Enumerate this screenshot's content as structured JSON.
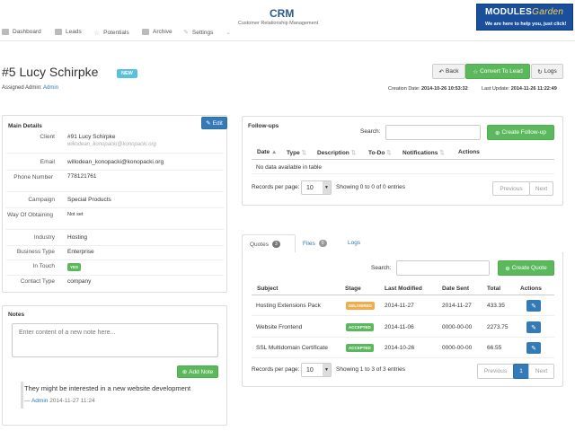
{
  "header": {
    "title": "CRM",
    "subtitle": "Customer Relationship Management",
    "nav": [
      {
        "label": "Dashboard",
        "icon": "chart-icon"
      },
      {
        "label": "Leads",
        "icon": "tag-icon"
      },
      {
        "label": "Potentials",
        "icon": "star-icon"
      },
      {
        "label": "Archive",
        "icon": "archive-icon"
      },
      {
        "label": "Settings",
        "icon": "wrench-icon"
      }
    ],
    "logo_line1a": "M",
    "logo_line1b": "ODULES",
    "logo_line1c": "Garden",
    "logo_line2": "We are here to help you, just click!"
  },
  "lead": {
    "title": "#5  Lucy Schirpke",
    "badge": "NEW",
    "admin_label": "Assigned Admin:",
    "admin_name": "Admin",
    "created_label": "Creation Date:",
    "created_value": "2014-10-26 10:53:32",
    "updated_label": "Last Update:",
    "updated_value": "2014-11-26 11:22:49"
  },
  "actions": {
    "back": "Back",
    "convert": "Convert To Lead",
    "logs": "Logs"
  },
  "details": {
    "title": "Main Details",
    "edit": "Edit",
    "client_label": "Client",
    "client_link": "#91  Lucy Schirpke",
    "client_email": "willodean_konopacki@konopacki.org",
    "email_label": "Email",
    "email_value": "willodean_konopacki@konopacki.org",
    "phone_label": "Phone Number",
    "phone_value": "778121761",
    "campaign_label": "Campaign",
    "campaign_value": "Special Products",
    "way_label": "Way Of Obtaining",
    "way_value": "Not set",
    "industry_label": "Industry",
    "industry_value": "Hosting",
    "business_label": "Business Type",
    "business_value": "Enterprise",
    "touch_label": "In Touch",
    "touch_value": "YES",
    "contact_label": "Contact Type",
    "contact_value": "company"
  },
  "notes": {
    "title": "Notes",
    "placeholder": "Enter content of a new note here...",
    "add": "Add Note",
    "note_text": "They might be interested in a new website development",
    "note_author": "Admin",
    "note_date": "2014-11-27 11:24"
  },
  "followups": {
    "title": "Follow-ups",
    "search_label": "Search:",
    "create": "Create Follow-up",
    "columns": [
      "Date",
      "Type",
      "Description",
      "To-Do",
      "Notifications",
      "Actions"
    ],
    "empty": "No data available in table",
    "per_page_label": "Records per page:",
    "per_page": "10",
    "showing": "Showing 0 to 0 of 0 entries",
    "prev": "Previous",
    "next": "Next"
  },
  "quotes": {
    "tabs": [
      {
        "label": "Quotes",
        "count": "3"
      },
      {
        "label": "Files",
        "count": "0"
      },
      {
        "label": "Logs",
        "count": ""
      }
    ],
    "search_label": "Search:",
    "create": "Create Quote",
    "columns": [
      "Subject",
      "Stage",
      "Last Modified",
      "Date Sent",
      "Total",
      "Actions"
    ],
    "rows": [
      {
        "subject": "Hosting Extensions Pack",
        "stage": "DELIVERED",
        "stage_color": "#f0ad4e",
        "modified": "2014-11-27",
        "sent": "2014-11-27",
        "total": "433.35"
      },
      {
        "subject": "Website Frontend",
        "stage": "ACCEPTED",
        "stage_color": "#5cb85c",
        "modified": "2014-11-06",
        "sent": "0000-00-00",
        "total": "2273.75"
      },
      {
        "subject": "SSL Multidomain Certificate",
        "stage": "ACCEPTED",
        "stage_color": "#5cb85c",
        "modified": "2014-10-26",
        "sent": "0000-00-00",
        "total": "66.55"
      }
    ],
    "per_page_label": "Records per page:",
    "per_page": "10",
    "showing": "Showing 1 to 3 of 3 entries",
    "prev": "Previous",
    "page": "1",
    "next": "Next"
  }
}
